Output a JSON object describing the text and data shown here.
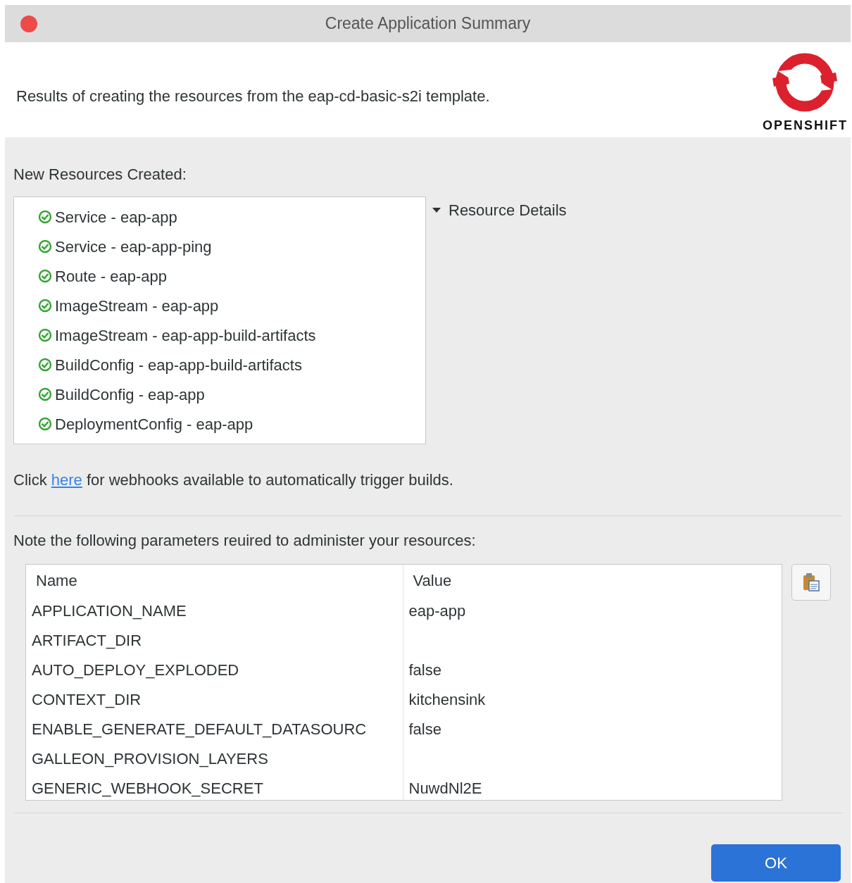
{
  "window": {
    "title": "Create Application Summary"
  },
  "header": {
    "description": "Results of creating the resources from the eap-cd-basic-s2i template.",
    "logo_text": "OPENSHIFT"
  },
  "resources": {
    "label": "New Resources Created:",
    "items": [
      {
        "label": "Service - eap-app"
      },
      {
        "label": "Service - eap-app-ping"
      },
      {
        "label": "Route - eap-app"
      },
      {
        "label": "ImageStream - eap-app"
      },
      {
        "label": "ImageStream - eap-app-build-artifacts"
      },
      {
        "label": "BuildConfig - eap-app-build-artifacts"
      },
      {
        "label": "BuildConfig - eap-app"
      },
      {
        "label": "DeploymentConfig - eap-app"
      }
    ]
  },
  "details": {
    "label": "Resource Details",
    "expanded": true
  },
  "webhooks": {
    "before": "Click",
    "link": "here",
    "after": "for webhooks available to automatically trigger builds."
  },
  "parameters": {
    "label": "Note the following parameters reuired to administer your resources:",
    "columns": [
      "Name",
      "Value"
    ],
    "rows": [
      [
        "APPLICATION_NAME",
        "eap-app"
      ],
      [
        "ARTIFACT_DIR",
        ""
      ],
      [
        "AUTO_DEPLOY_EXPLODED",
        "false"
      ],
      [
        "CONTEXT_DIR",
        "kitchensink"
      ],
      [
        "ENABLE_GENERATE_DEFAULT_DATASOURC",
        "false"
      ],
      [
        "GALLEON_PROVISION_LAYERS",
        ""
      ],
      [
        "GENERIC_WEBHOOK_SECRET",
        "NuwdNl2E"
      ]
    ]
  },
  "buttons": [
    "OK"
  ]
}
